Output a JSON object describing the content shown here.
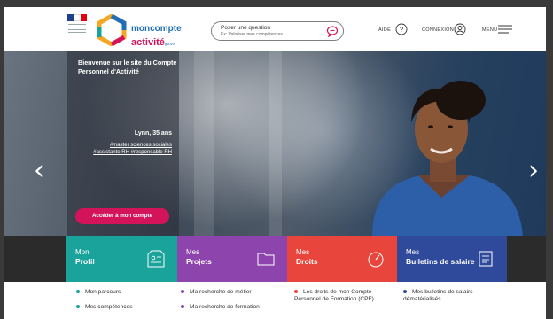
{
  "header": {
    "brand": {
      "line1": "moncompte",
      "line2": "activité",
      "line3": "gouv.fr"
    },
    "search": {
      "line1": "Poser une question",
      "line2": "Ex: Valoriser mes compétences"
    },
    "nav": {
      "aide": "AIDE",
      "connexion": "CONNEXION",
      "menu": "MENU"
    }
  },
  "hero": {
    "title": "Bienvenue sur le site du Compte Personnel d'Activité",
    "name": "Lynn, 35 ans",
    "tags": [
      "#master sciences sociales",
      "#assistante RH #responsable RH"
    ],
    "cta": "Accéder à mon compte",
    "arrow_left": "‹",
    "arrow_right": "›"
  },
  "tiles": [
    {
      "line1": "Mon",
      "line2": "Profil",
      "color": "#1aa39a"
    },
    {
      "line1": "Mes",
      "line2": "Projets",
      "color": "#8e44ad"
    },
    {
      "line1": "Mes",
      "line2": "Droits",
      "color": "#e8463c"
    },
    {
      "line1": "Mes",
      "line2": "Bulletins de salaire",
      "color": "#2f4a9a"
    }
  ],
  "lists": {
    "col1": [
      "Mon parcours",
      "Mes compétences"
    ],
    "col2": [
      "Ma recherche de métier",
      "Ma recherche de formation"
    ],
    "col3": [
      "Les droits de mon Compte Personnel de Formation (CPF)"
    ],
    "col4": [
      "Mes bulletins de salairs dématérialisés"
    ],
    "dot_colors": {
      "col1": "#1aa39a",
      "col2": "#8e44ad",
      "col3": "#e8463c",
      "col4": "#2f4a9a"
    }
  }
}
